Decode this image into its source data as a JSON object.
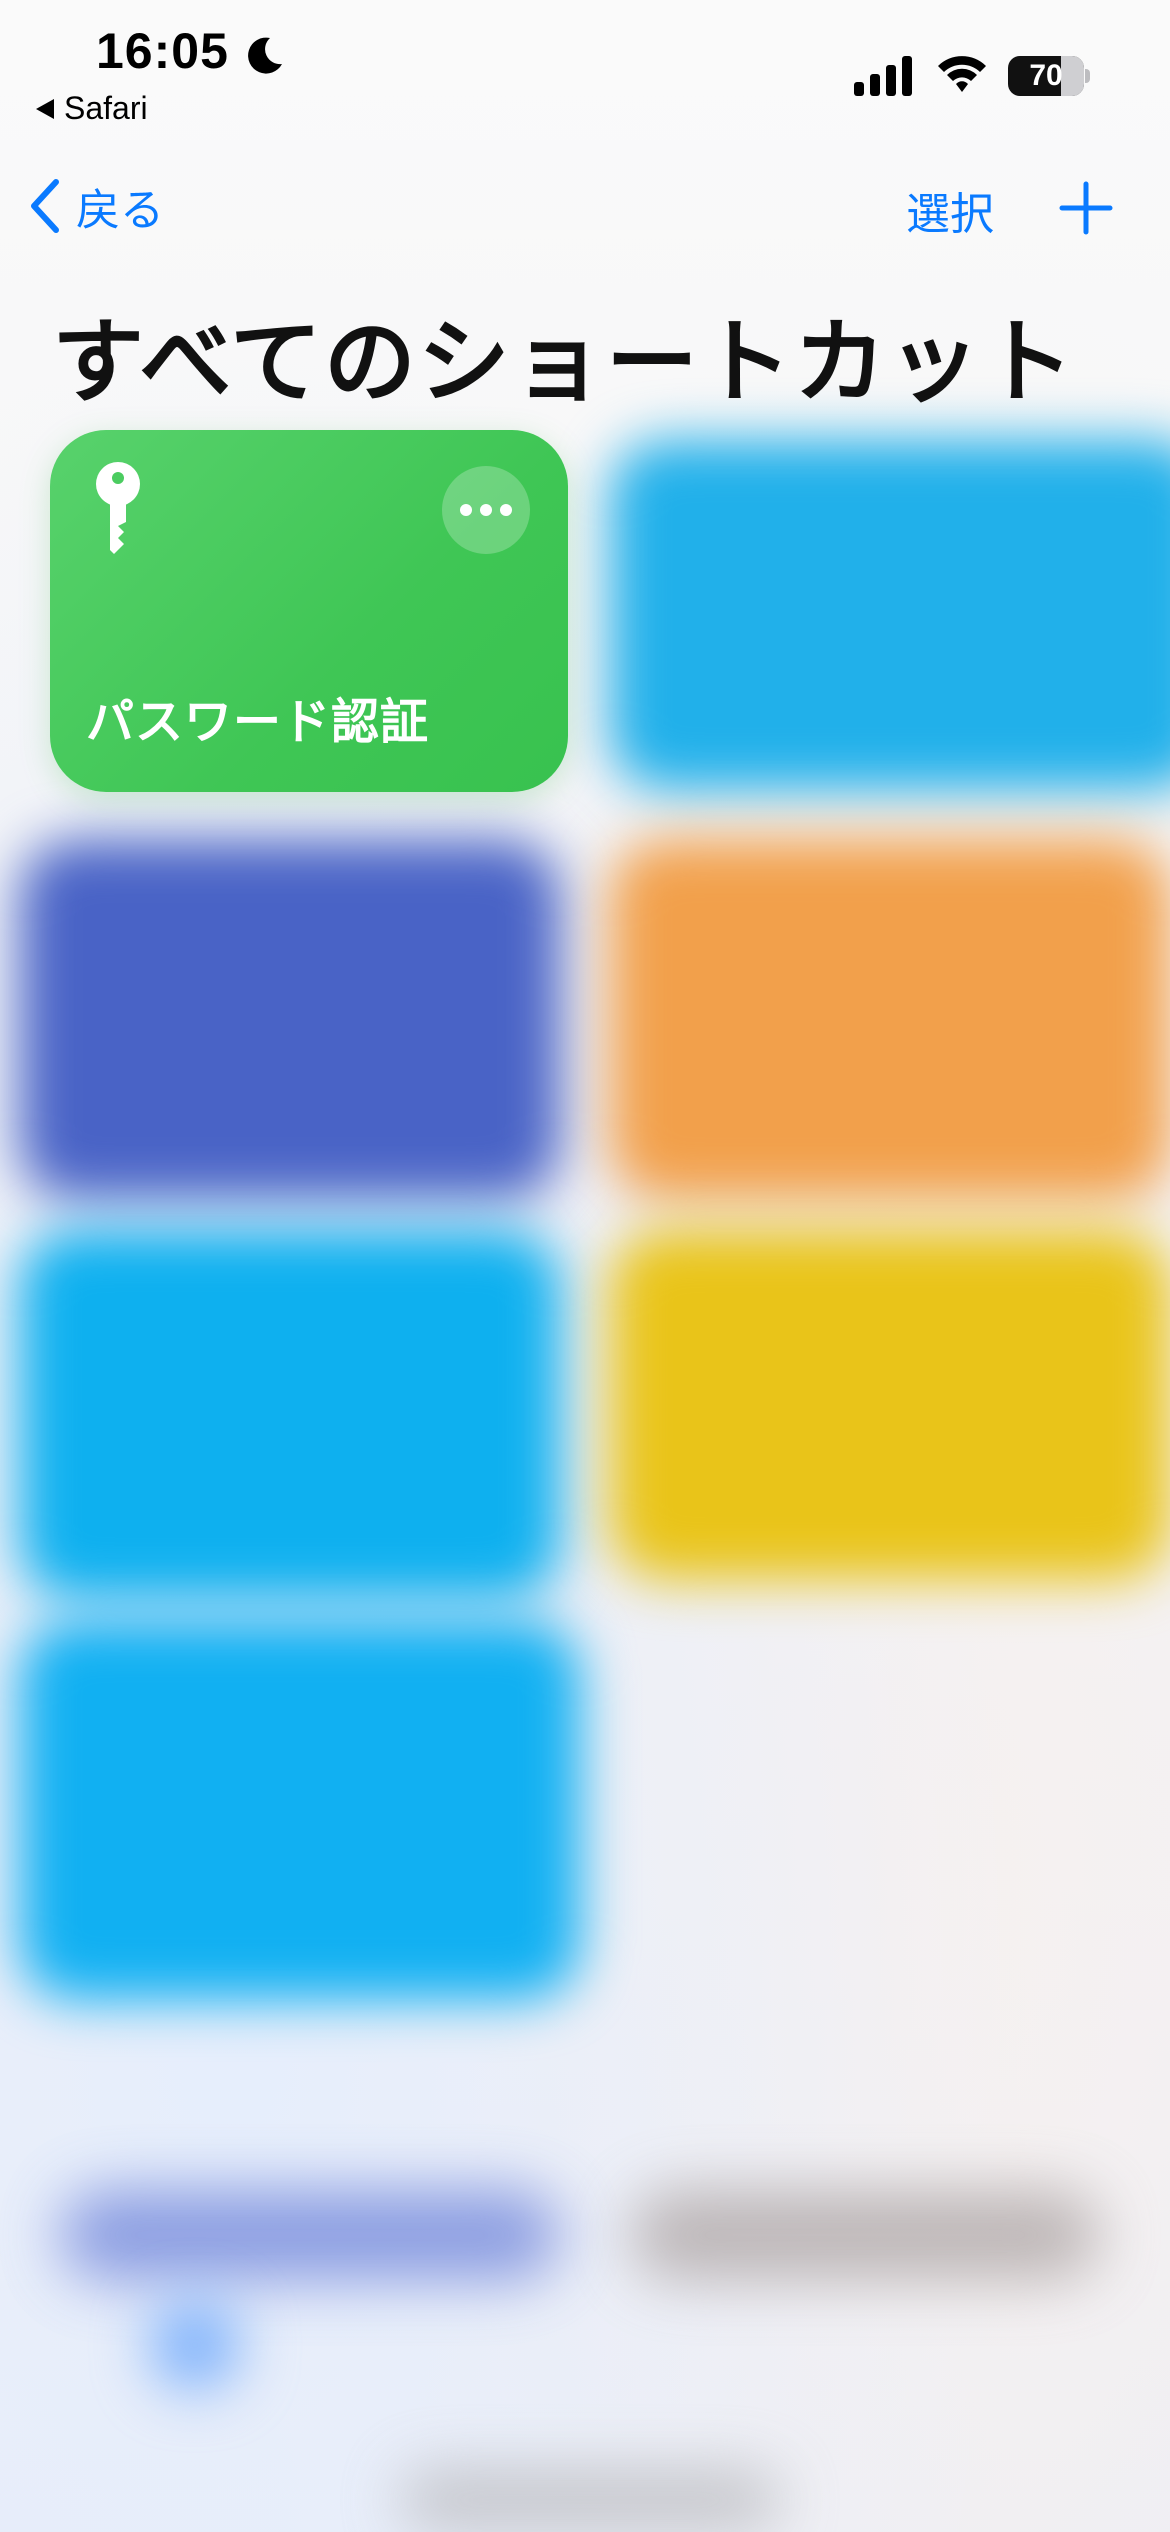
{
  "status_bar": {
    "time": "16:05",
    "back_app": "Safari",
    "battery": "70",
    "battery_level": 0.7,
    "icons": [
      "moon-icon",
      "cellular-signal-icon",
      "wifi-icon",
      "battery-icon"
    ]
  },
  "nav": {
    "back_label": "戻る",
    "select_label": "選択",
    "add_icon": "plus-icon"
  },
  "page": {
    "title": "すべてのショートカット"
  },
  "shortcuts": [
    {
      "label": "パスワード認証",
      "icon": "key-icon",
      "color": "#3fc655"
    }
  ],
  "colors": {
    "accent": "#0a7aff",
    "tile_green": "#3fc655",
    "blurred_tiles": [
      "#21b0ea",
      "#4963c6",
      "#f2a04b",
      "#0eb0ef",
      "#e9c419",
      "#11b0f2"
    ]
  }
}
